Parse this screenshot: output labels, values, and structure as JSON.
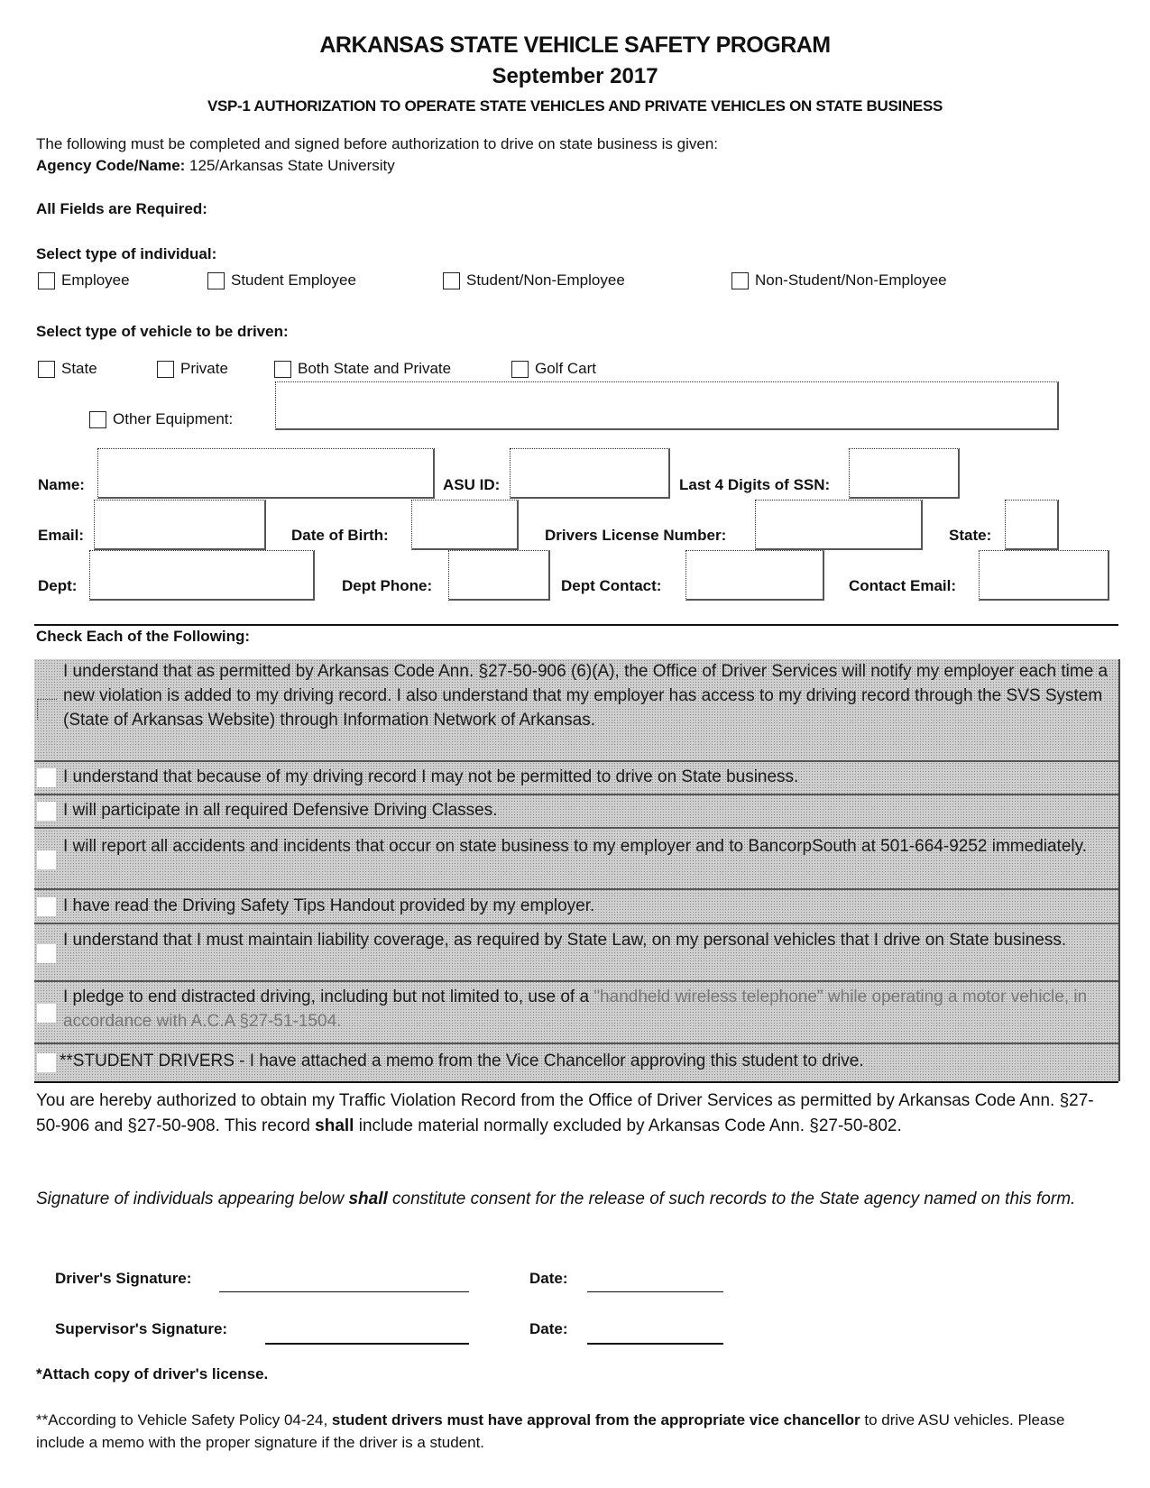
{
  "header": {
    "title": "ARKANSAS STATE VEHICLE SAFETY PROGRAM",
    "date": "September 2017",
    "subtitle": "VSP-1 AUTHORIZATION TO OPERATE STATE VEHICLES AND PRIVATE VEHICLES ON STATE BUSINESS"
  },
  "intro": {
    "text": "The following must be completed and signed before authorization to drive on state business is given:",
    "agency_label": "Agency Code/Name:",
    "agency_value": " 125/Arkansas State University"
  },
  "required_note": "All Fields are Required:",
  "individual": {
    "heading": "Select type of individual:",
    "options": [
      {
        "label": "Employee",
        "checked": false
      },
      {
        "label": "Student Employee",
        "checked": false
      },
      {
        "label": "Student/Non-Employee",
        "checked": false
      },
      {
        "label": "Non-Student/Non-Employee",
        "checked": false
      }
    ]
  },
  "vehicle": {
    "heading": "Select type of vehicle to be driven:",
    "options": [
      {
        "label": "State",
        "checked": false
      },
      {
        "label": "Private",
        "checked": false
      },
      {
        "label": "Both State and Private",
        "checked": false
      },
      {
        "label": "Golf Cart",
        "checked": false
      },
      {
        "label": "Other Equipment:",
        "checked": false
      }
    ],
    "other_value": ""
  },
  "fields": {
    "name": {
      "label": "Name:",
      "value": ""
    },
    "asu_id": {
      "label": "ASU ID:",
      "value": ""
    },
    "ssn4": {
      "label": "Last 4 Digits of SSN:",
      "value": ""
    },
    "email": {
      "label": "Email:",
      "value": ""
    },
    "dob": {
      "label": "Date of Birth:",
      "value": ""
    },
    "dl_number": {
      "label": "Drivers License Number:",
      "value": ""
    },
    "state": {
      "label": "State:",
      "value": ""
    },
    "dept": {
      "label": "Dept:",
      "value": ""
    },
    "dept_phone": {
      "label": "Dept Phone:",
      "value": ""
    },
    "dept_contact": {
      "label": "Dept Contact:",
      "value": ""
    },
    "contact_email": {
      "label": "Contact Email:",
      "value": ""
    }
  },
  "checklist": {
    "heading": "Check Each of the Following:",
    "items": [
      {
        "text": "I understand that as permitted by Arkansas Code Ann. §27-50-906 (6)(A), the Office of Driver Services will notify my employer each time a new violation is added to my driving record.  I also understand that my employer has access to my driving record through the SVS System (State of Arkansas Website) through Information Network of Arkansas.",
        "checked": false
      },
      {
        "text": "I understand that because of my driving record I may not be permitted to drive on State business.",
        "checked": false
      },
      {
        "text": "I will participate in all required Defensive Driving Classes.",
        "checked": false
      },
      {
        "text": "I will report all accidents and incidents that occur on state business to my employer and to BancorpSouth at 501-664-9252 immediately.",
        "checked": false
      },
      {
        "text": "I have read the Driving Safety Tips Handout provided by my employer.",
        "checked": false
      },
      {
        "text": "I understand that I must maintain liability coverage, as required by State Law, on my personal vehicles that I drive on State business.",
        "checked": false
      },
      {
        "text": "I pledge to end distracted driving, including but not limited to, use of a ",
        "faded": "\"handheld wireless telephone\" while operating a motor vehicle, in accordance with A.C.A §27-51-1504.",
        "checked": false
      },
      {
        "text": "**STUDENT DRIVERS - I have attached a memo from the Vice Chancellor approving this student to drive.",
        "checked": false
      }
    ]
  },
  "authorization": {
    "part1": "You are hereby authorized to obtain my Traffic Violation Record from the Office of Driver Services as permitted by Arkansas Code Ann. §27-50-906 and §27-50-908.  This record ",
    "bold": "shall",
    "part2": " include material normally excluded by Arkansas Code Ann. §27-50-802."
  },
  "consent": {
    "part1": "Signature of individuals appearing below ",
    "bold": "shall",
    "part2": " constitute consent for the release of such records to the State agency named on this form."
  },
  "signatures": {
    "driver_label": "Driver's Signature:",
    "supervisor_label": "Supervisor's Signature:",
    "date_label": "Date:"
  },
  "footnotes": {
    "attach": "*Attach copy of driver's license.",
    "policy_part1": "**According to Vehicle Safety Policy 04-24, ",
    "policy_bold": "student drivers must have approval from the appropriate vice chancellor",
    "policy_part2": " to drive ASU vehicles. Please include a memo with the proper signature if the driver is a student."
  }
}
